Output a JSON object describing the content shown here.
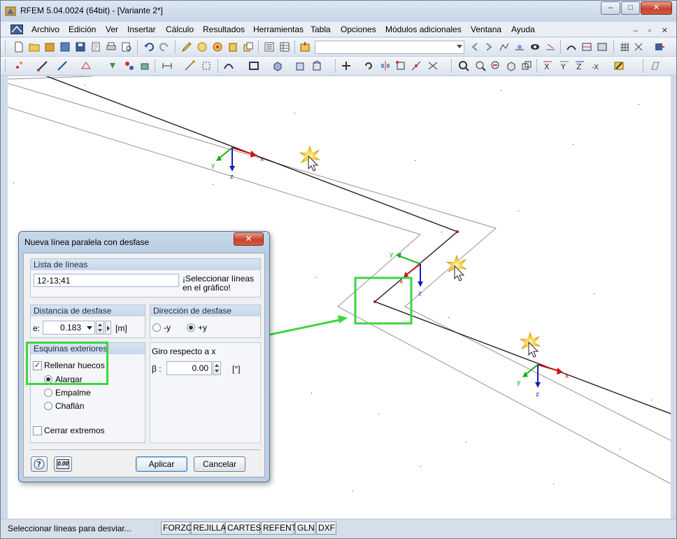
{
  "window": {
    "title": "RFEM 5.04.0024 (64bit) - [Variante 2*]",
    "minimize": "–",
    "maximize": "□",
    "close": "✕"
  },
  "menu": {
    "items": [
      "Archivo",
      "Edición",
      "Ver",
      "Insertar",
      "Cálculo",
      "Resultados",
      "Herramientas",
      "Tabla",
      "Opciones",
      "Módulos adicionales",
      "Ventana",
      "Ayuda"
    ],
    "mdi": "– ▫ ✕"
  },
  "toolbar": {
    "combo_value": ""
  },
  "canvas": {
    "axis_labels": [
      {
        "text": "x"
      },
      {
        "text": "y"
      },
      {
        "text": "z"
      },
      {
        "text": "x"
      },
      {
        "text": "y"
      },
      {
        "text": "z"
      },
      {
        "text": "x"
      },
      {
        "text": "y"
      },
      {
        "text": "z"
      }
    ],
    "colors": {
      "x_axis": "#d01010",
      "y_axis": "#10b010",
      "z_axis": "#1020c0",
      "highlight": "#3ed63e"
    }
  },
  "dialog": {
    "title": "Nueva línea paralela con desfase",
    "close": "✕",
    "lines_group": {
      "header": "Lista de líneas",
      "value": "12-13;41",
      "hint": "¡Seleccionar líneas en el gráfico!"
    },
    "offset_group": {
      "header": "Distancia de desfase",
      "label": "e:",
      "value": "0.183",
      "unit": "[m]"
    },
    "direction_group": {
      "header": "Dirección de desfase",
      "option_neg": "-y",
      "option_pos": "+y",
      "selected": "+y"
    },
    "corners_group": {
      "header": "Esquinas exteriores",
      "fill_gaps_label": "Rellenar huecos",
      "fill_gaps_checked": true,
      "options": [
        "Alargar",
        "Empalme",
        "Chaflán"
      ],
      "selected": "Alargar",
      "close_ends_label": "Cerrar extremos",
      "close_ends_checked": false
    },
    "rotation_group": {
      "label": "Giro respecto a x",
      "symbol": "β :",
      "value": "0.00",
      "unit": "[°]"
    },
    "buttons": {
      "help_icon": "help-icon",
      "units_icon_text": "0.00",
      "apply": "Aplicar",
      "cancel": "Cancelar"
    }
  },
  "statusbar": {
    "text": "Seleccionar líneas para desviar...",
    "buttons": [
      "FORZC",
      "REJILLA",
      "CARTES",
      "REFENT",
      "GLN",
      "DXF"
    ]
  }
}
